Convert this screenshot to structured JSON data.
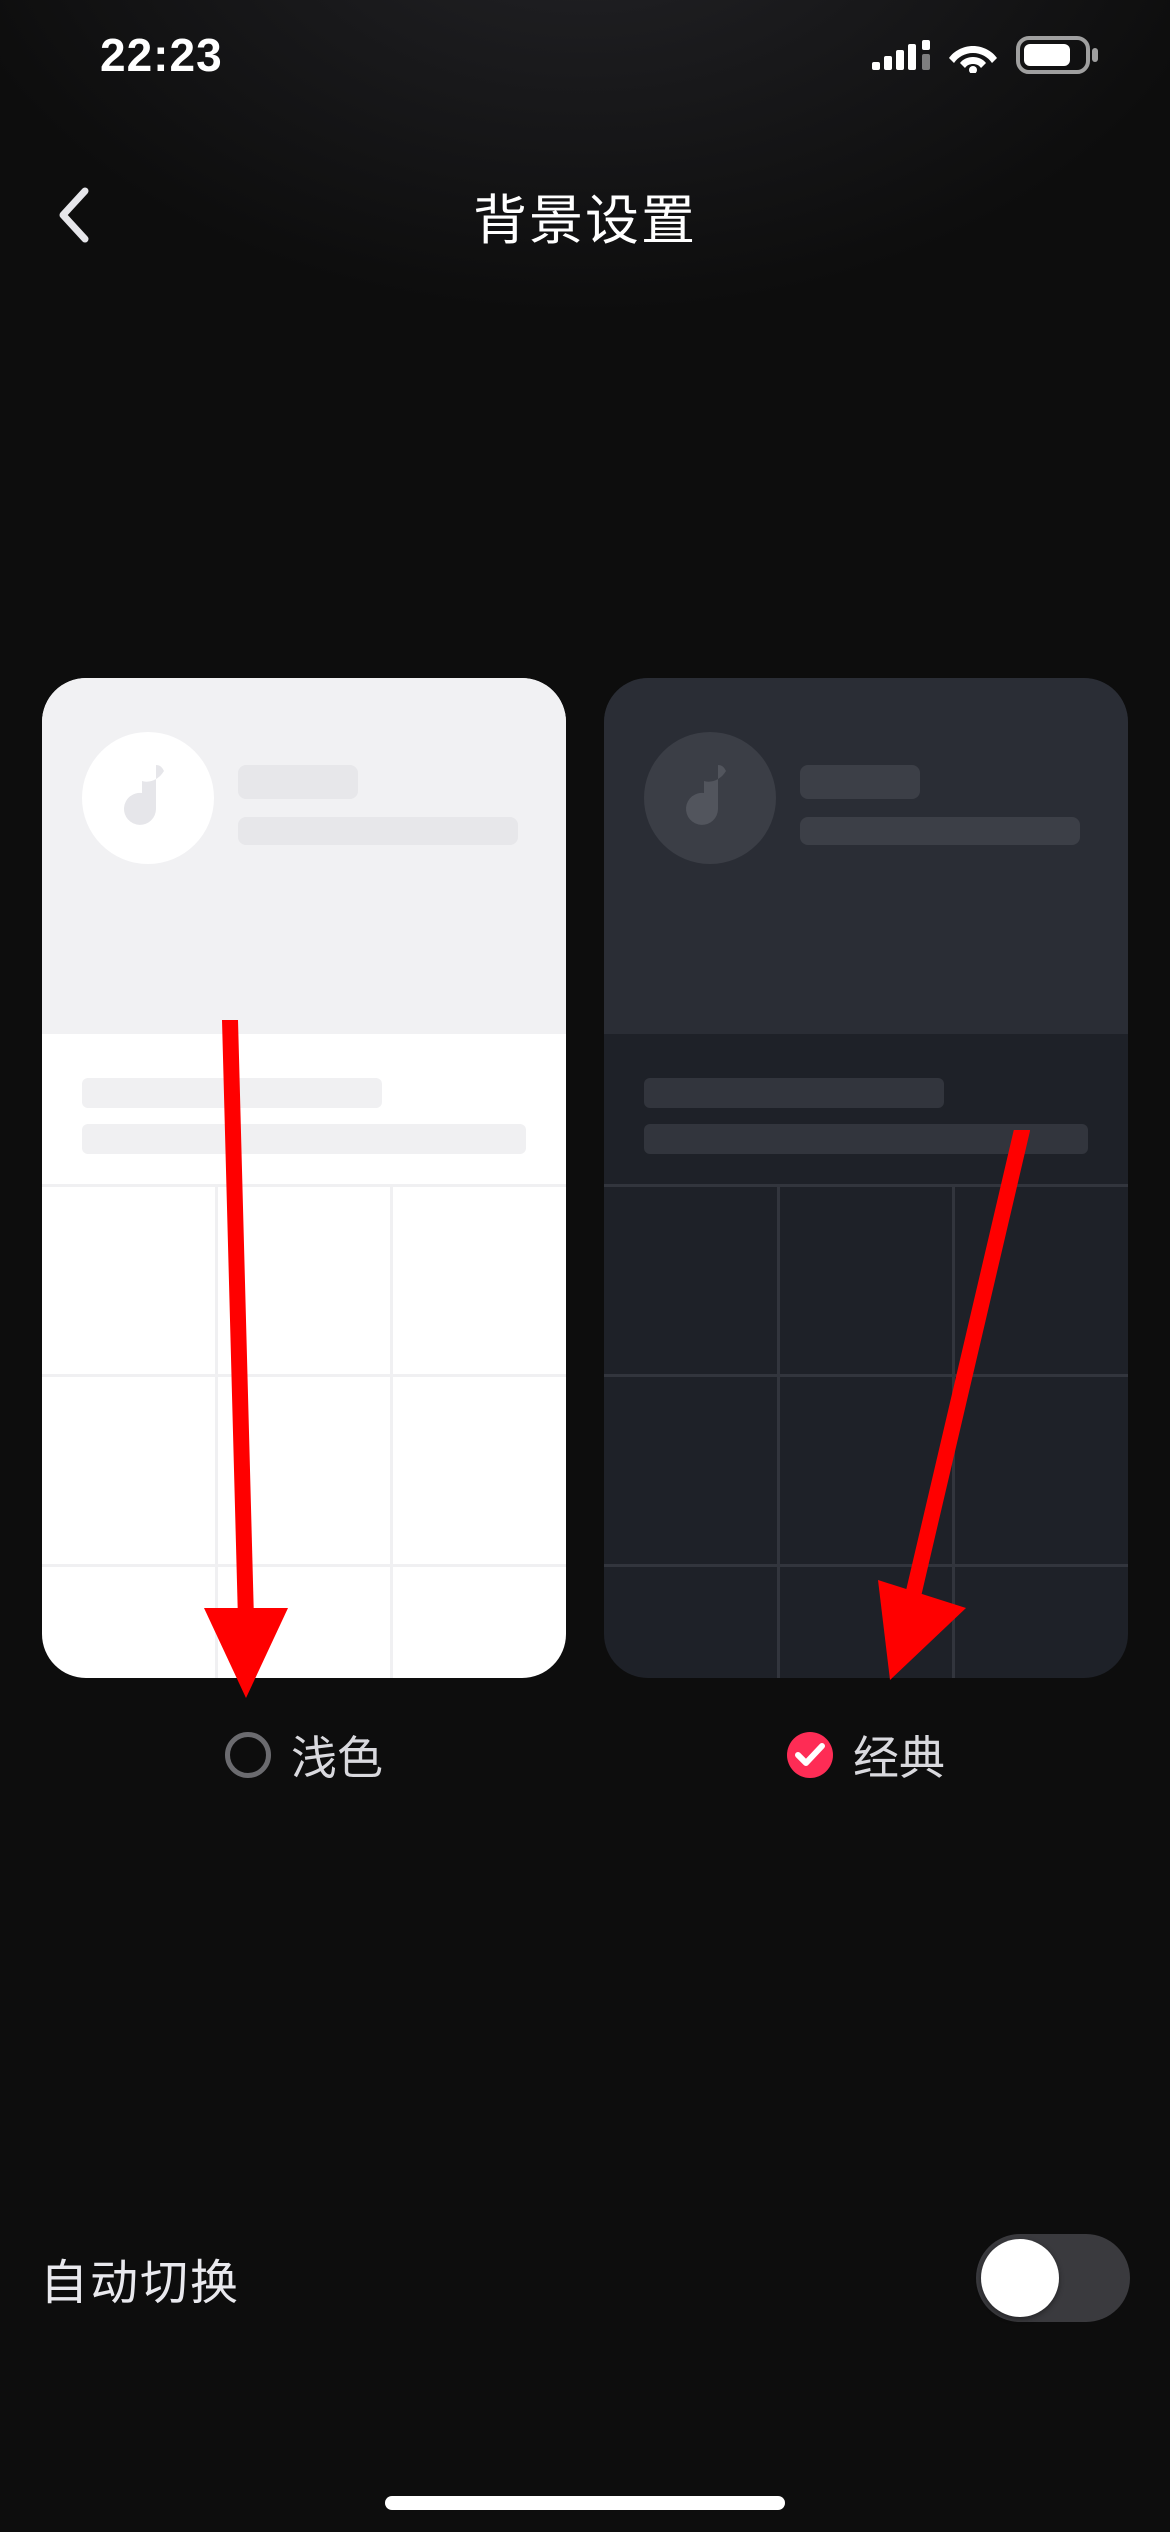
{
  "status": {
    "time": "22:23"
  },
  "nav": {
    "title": "背景设置"
  },
  "themes": {
    "light": {
      "label": "浅色",
      "selected": false
    },
    "classic": {
      "label": "经典",
      "selected": true
    }
  },
  "settings": {
    "autoSwitchLabel": "自动切换",
    "autoSwitchOn": false
  },
  "colors": {
    "accent": "#fe2c55",
    "annotation": "#ff0000"
  }
}
